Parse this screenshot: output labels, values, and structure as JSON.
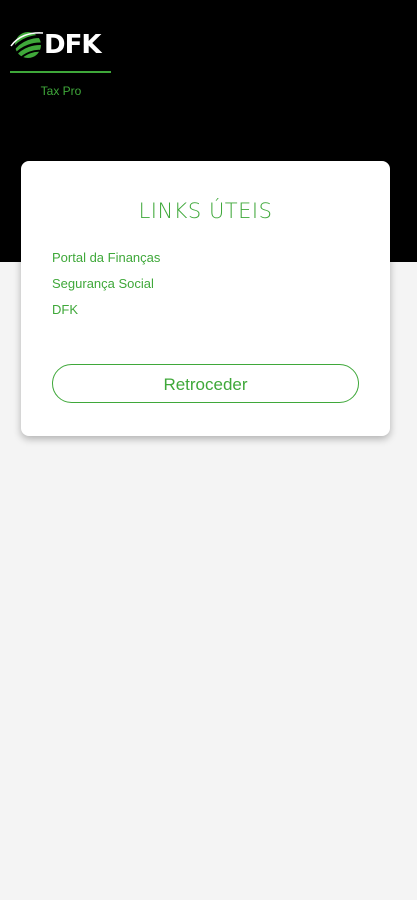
{
  "brand": {
    "logo_icon": "dfk-globe-mark-icon",
    "name": "DFK",
    "subtitle": "Tax Pro"
  },
  "card": {
    "title": "LINKS ÚTEIS",
    "links": [
      {
        "label": "Portal da Finanças"
      },
      {
        "label": "Segurança Social"
      },
      {
        "label": "DFK"
      }
    ],
    "back_button_label": "Retroceder"
  },
  "colors": {
    "accent": "#3fa83a",
    "header_background": "#000000",
    "page_background": "#f4f4f4",
    "card_background": "#ffffff"
  }
}
